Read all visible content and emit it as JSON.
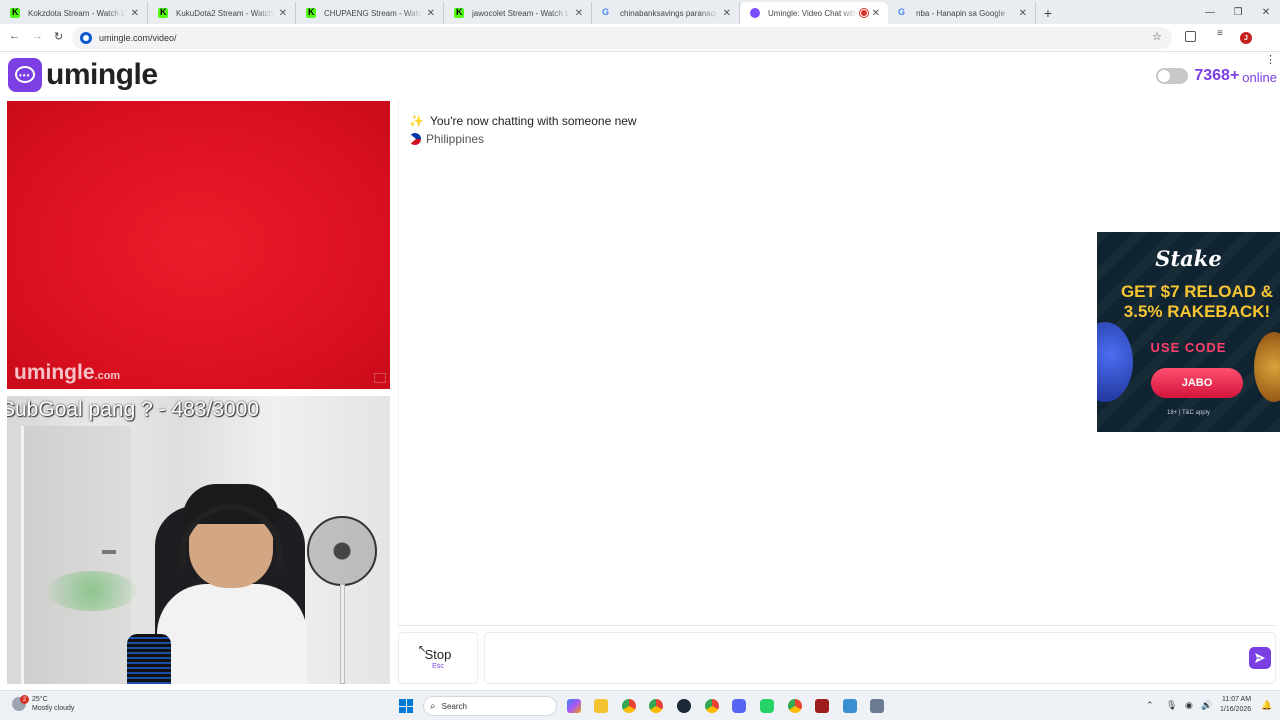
{
  "browser": {
    "tabs": [
      {
        "title": "Kokzdota Stream - Watch Live",
        "favicon": "kick-icon"
      },
      {
        "title": "KukuDota2 Stream - Watch Live",
        "favicon": "kick-icon"
      },
      {
        "title": "CHUPAENG Stream - Watch Live",
        "favicon": "kick-icon"
      },
      {
        "title": "jawocolet Stream - Watch Live",
        "favicon": "kick-icon"
      },
      {
        "title": "chinabanksavings paranaque",
        "favicon": "google-icon"
      },
      {
        "title": "Umingle: Video Chat with S",
        "favicon": "umingle-icon",
        "active": true,
        "recording": true
      },
      {
        "title": "nba - Hanapin sa Google",
        "favicon": "google-icon"
      }
    ],
    "url": "umingle.com/video/",
    "profile_initial": "J"
  },
  "header": {
    "logo_text": "umingle",
    "online_count": "7368+",
    "online_label": "online"
  },
  "stranger_video": {
    "watermark_main": "umingle",
    "watermark_suffix": ".com"
  },
  "self_video": {
    "overlay_text": "SubGoal pang ? - 483/3000"
  },
  "chat": {
    "system_message": "You're now chatting with someone new",
    "country": "Philippines"
  },
  "ad": {
    "brand": "Stake",
    "headline_line1": "GET $7 RELOAD &",
    "headline_line2": "3.5% RAKEBACK!",
    "cta_label": "USE CODE",
    "code": "JABO",
    "terms": "18+ | T&C apply"
  },
  "controls": {
    "stop_label": "Stop",
    "stop_shortcut": "Esc",
    "message_placeholder": ""
  },
  "taskbar": {
    "temperature": "25°C",
    "weather_desc": "Mostly cloudy",
    "weather_badge": "2",
    "search_label": "Search",
    "time": "11:07 AM",
    "date": "1/16/2026"
  },
  "colors": {
    "brand_purple": "#7b3fe4",
    "stranger_bg": "#e3141f",
    "ad_bg": "#0f2330",
    "ad_gold": "#f6c531"
  }
}
